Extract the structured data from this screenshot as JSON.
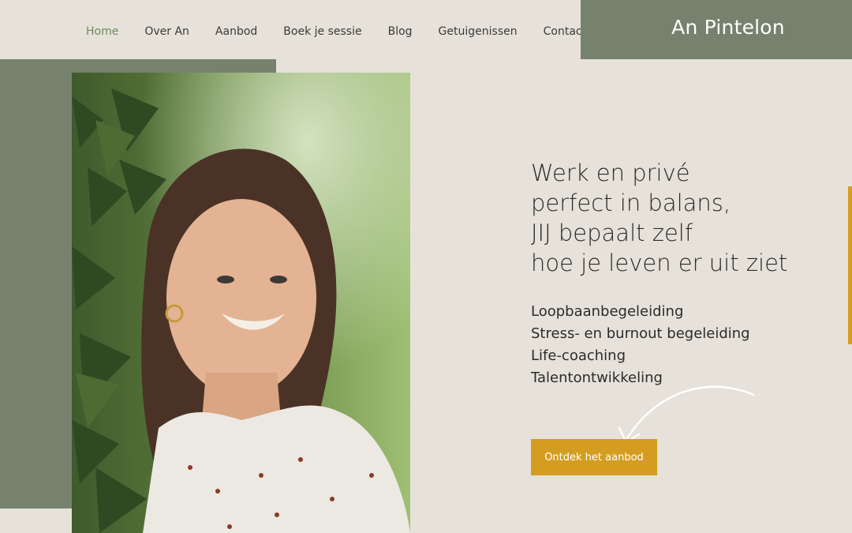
{
  "nav": {
    "items": [
      {
        "label": "Home",
        "active": true
      },
      {
        "label": "Over An",
        "active": false
      },
      {
        "label": "Aanbod",
        "active": false
      },
      {
        "label": "Boek je sessie",
        "active": false
      },
      {
        "label": "Blog",
        "active": false
      },
      {
        "label": "Getuigenissen",
        "active": false
      },
      {
        "label": "Contact",
        "active": false
      }
    ]
  },
  "brand": {
    "name": "An Pintelon"
  },
  "hero": {
    "headline_lines": [
      "Werk en privé",
      "perfect in balans,",
      "JIJ bepaalt zelf",
      "hoe je leven er uit ziet"
    ],
    "services": [
      "Loopbaanbegeleiding",
      "Stress- en burnout begeleiding",
      "Life-coaching",
      "Talentontwikkeling"
    ],
    "cta_label": "Ontdek het aanbod"
  },
  "colors": {
    "background": "#e6e2d9",
    "sage": "#77826e",
    "accent": "#d49d22",
    "nav_active": "#6f8a5f"
  },
  "icons": {
    "arrow": "curved-arrow-icon"
  }
}
